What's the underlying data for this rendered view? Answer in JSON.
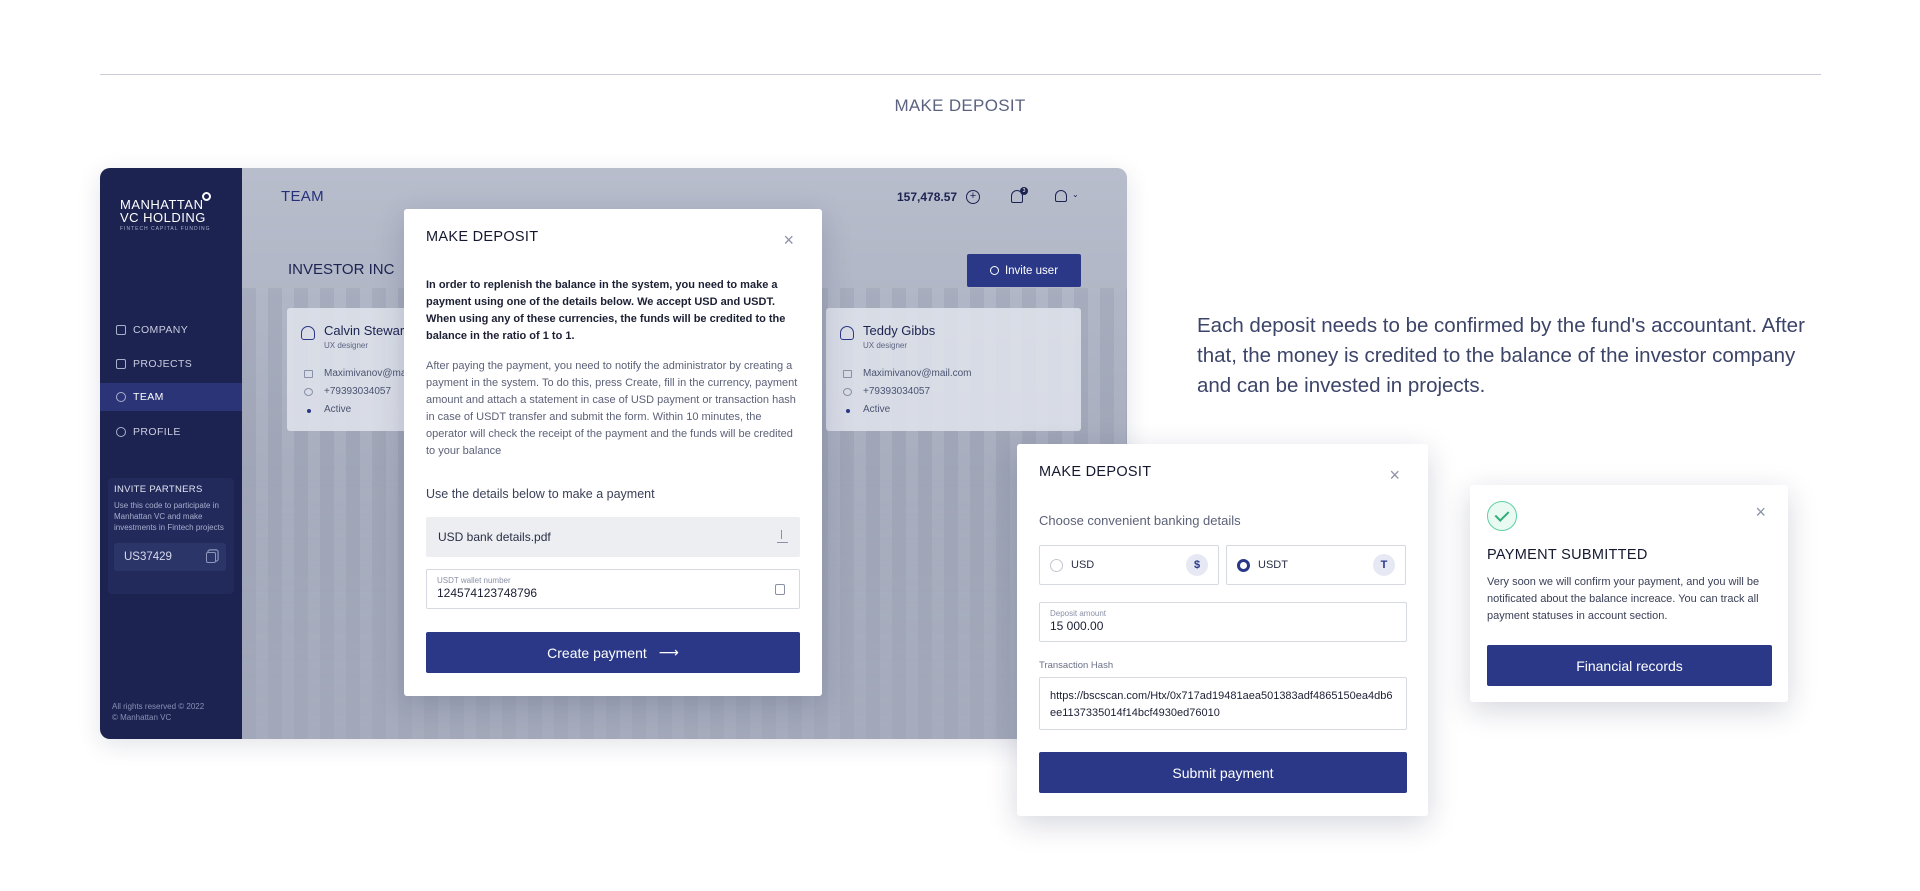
{
  "section_heading": "MAKE DEPOSIT",
  "app": {
    "logo": {
      "line1": "MANHATTAN",
      "line2": "VC HOLDING",
      "tagline": "FINTECH CAPITAL FUNDING"
    },
    "nav": [
      {
        "label": "COMPANY",
        "icon": "building-icon"
      },
      {
        "label": "PROJECTS",
        "icon": "briefcase-icon"
      },
      {
        "label": "TEAM",
        "icon": "team-icon",
        "active": true
      },
      {
        "label": "PROFILE",
        "icon": "profile-icon"
      }
    ],
    "invite": {
      "title": "INVITE PARTNERS",
      "description": "Use this code to participate in Manhattan VC and make investments in Fintech projects",
      "code": "US37429"
    },
    "footer": {
      "line1": "All rights reserved © 2022",
      "line2": "© Manhattan VC"
    },
    "header": {
      "title": "TEAM",
      "balance": "157,478.57",
      "notifications_count": "3"
    },
    "company_name": "INVESTOR INC",
    "invite_button": "Invite user",
    "team_cards": [
      {
        "name": "Calvin Stewart",
        "role": "UX designer",
        "email": "Maximivanov@mail.com",
        "phone": "+79393034057",
        "status": "Active"
      },
      {
        "name": "Teddy Gibbs",
        "role": "UX designer",
        "email": "Maximivanov@mail.com",
        "phone": "+79393034057",
        "status": "Active"
      }
    ]
  },
  "deposit_modal": {
    "title": "MAKE DEPOSIT",
    "intro_bold": "In order to replenish the balance in the system, you need to make a payment using one of the details below. We accept USD and USDT. When using any of these currencies, the funds will be credited to the balance in the ratio of 1 to 1.",
    "intro_text": "After paying the payment, you need to notify the administrator by creating a payment in the system. To do this, press Create, fill in the currency, payment amount and attach a statement in case of USD payment or transaction hash in case of USDT transfer and submit the form. Within 10 minutes, the operator will check the receipt of the payment and the funds will be credited to your balance",
    "details_heading": "Use the details below to make a payment",
    "file_name": "USD bank details.pdf",
    "wallet_label": "USDT wallet number",
    "wallet_value": "124574123748796",
    "create_button": "Create payment",
    "create_arrow": "⟶"
  },
  "description": "Each deposit needs to be confirmed by the fund's accountant. After that, the money is credited to the balance of the investor company and can be invested in projects.",
  "payment_modal": {
    "title": "MAKE DEPOSIT",
    "subtitle": "Choose convenient banking details",
    "options": [
      {
        "label": "USD",
        "symbol": "$",
        "selected": false
      },
      {
        "label": "USDT",
        "symbol": "T",
        "selected": true
      }
    ],
    "amount_label": "Deposit amount",
    "amount_value": "15 000.00",
    "hash_label": "Transaction Hash",
    "hash_value": "https://bscscan.com/Htx/0x717ad19481aea501383adf4865150ea4db6ee1137335014f14bcf4930ed76010",
    "submit_button": "Submit payment"
  },
  "submitted_modal": {
    "title": "PAYMENT SUBMITTED",
    "text": "Very soon we will confirm your payment, and you will be notificated about the balance increace. You can track all payment statuses in account section.",
    "button": "Financial records"
  },
  "colors": {
    "navy": "#1c2351",
    "primary": "#2a3887",
    "success": "#2fae7a"
  }
}
